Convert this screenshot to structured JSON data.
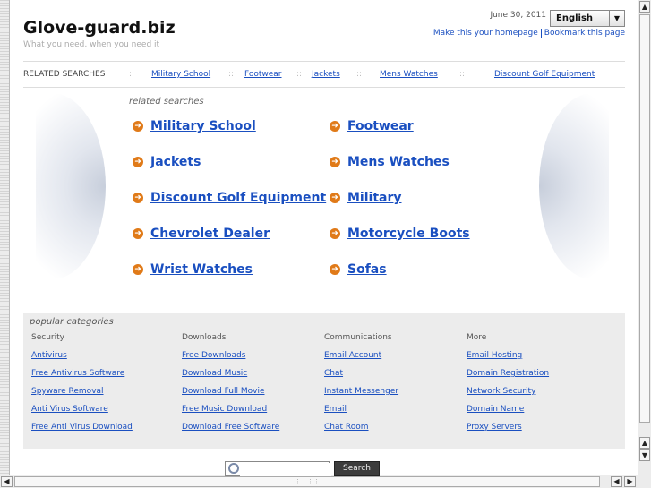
{
  "site": {
    "title": "Glove-guard.biz",
    "tagline": "What you need, when you need it"
  },
  "header": {
    "date": "June 30, 2011",
    "language": "English",
    "links": [
      "Make this your homepage",
      "Bookmark this page"
    ]
  },
  "related_bar": {
    "label": "RELATED SEARCHES",
    "separator": "::",
    "items": [
      "Military School",
      "Footwear",
      "Jackets",
      "Mens Watches",
      "Discount Golf Equipment"
    ]
  },
  "related": {
    "heading": "related searches",
    "items": [
      "Military School",
      "Footwear",
      "Jackets",
      "Mens Watches",
      "Discount Golf Equipment",
      "Military",
      "Chevrolet Dealer",
      "Motorcycle Boots",
      "Wrist Watches",
      "Sofas"
    ]
  },
  "popular": {
    "heading": "popular categories",
    "columns": [
      {
        "title": "Security",
        "links": [
          "Antivirus",
          "Free Antivirus Software",
          "Spyware Removal",
          "Anti Virus Software",
          "Free Anti Virus Download"
        ]
      },
      {
        "title": "Downloads",
        "links": [
          "Free Downloads",
          "Download Music",
          "Download Full Movie",
          "Free Music Download",
          "Download Free Software"
        ]
      },
      {
        "title": "Communications",
        "links": [
          "Email Account",
          "Chat",
          "Instant Messenger",
          "Email",
          "Chat Room"
        ]
      },
      {
        "title": "More",
        "links": [
          "Email Hosting",
          "Domain Registration",
          "Network Security",
          "Domain Name",
          "Proxy Servers"
        ]
      }
    ]
  },
  "search": {
    "value": "",
    "button": "Search"
  },
  "icons": {
    "language_dropdown": "chevron-down-icon",
    "related_bullet": "arrow-right-circle-icon",
    "search": "search-icon"
  },
  "colors": {
    "link": "#1a4fc0",
    "bullet": "#e07a18",
    "panel": "#ececec",
    "search_button": "#3c3c3c"
  }
}
